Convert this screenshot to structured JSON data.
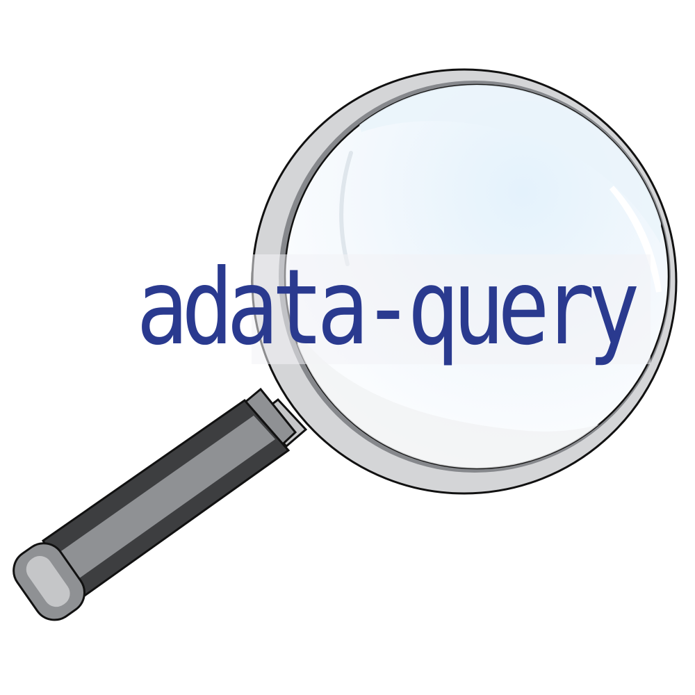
{
  "logo": {
    "wordmark": "adata-query",
    "icon": "magnifying-glass-icon",
    "colors": {
      "text": "#2a3a8f",
      "rim_light": "#d4d5d7",
      "rim_dark": "#86888c",
      "outline": "#111111",
      "lens_tint": "#e9f3fb",
      "handle_dark": "#3d3e40",
      "handle_mid": "#8f9194",
      "handle_light": "#c5c6c8",
      "background": "#ffffff"
    }
  }
}
